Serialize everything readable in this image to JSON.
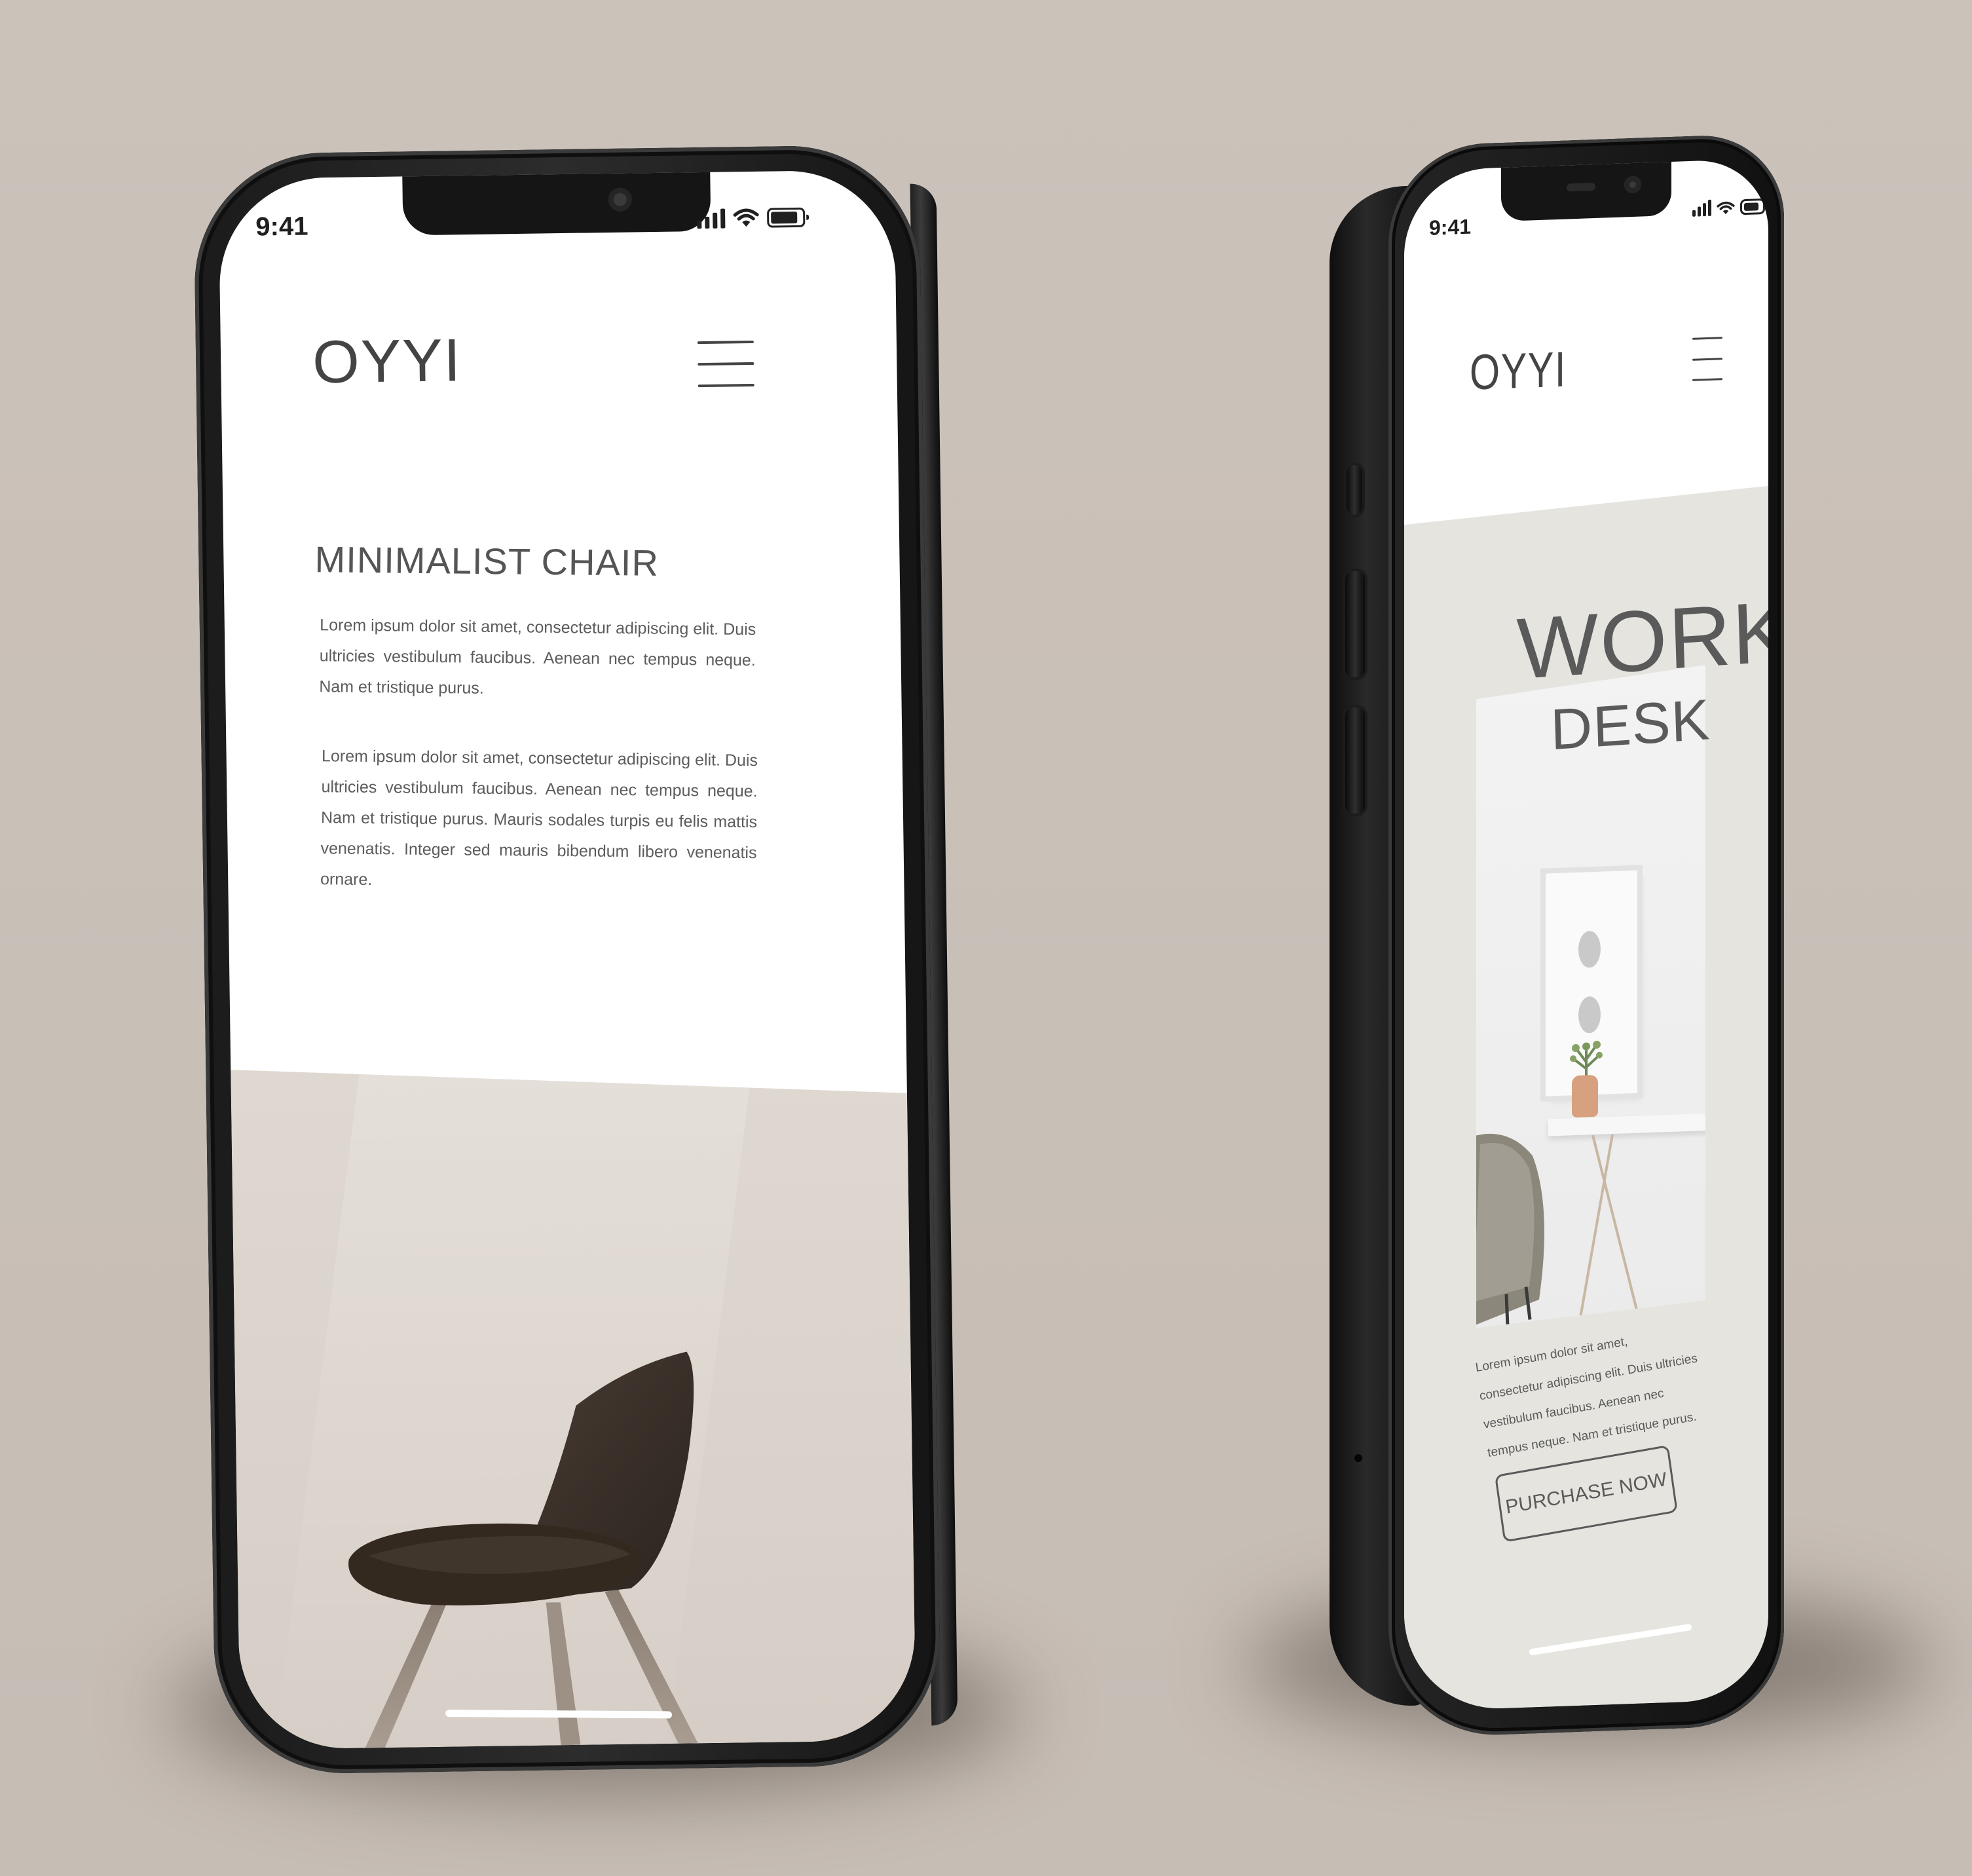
{
  "phone1": {
    "status": {
      "time": "9:41"
    },
    "brand": "OYYI",
    "product_title": "MINIMALIST CHAIR",
    "paragraphs": [
      "Lorem ipsum dolor sit amet, consectetur adipiscing elit. Duis ultricies vestibulum faucibus. Aenean nec tempus neque. Nam et tristique purus.",
      "Lorem ipsum dolor sit amet, consectetur adipiscing elit. Duis ultricies vestibulum faucibus. Aenean nec tempus neque. Nam et tristique purus. Mauris sodales turpis eu felis mattis venenatis. Integer sed mauris bibendum libero venenatis ornare."
    ]
  },
  "phone2": {
    "status": {
      "time": "9:41"
    },
    "brand": "OYYI",
    "headline_line1": "WORK",
    "headline_line2": "DESK",
    "paragraph": "Lorem ipsum dolor sit amet, consectetur adipiscing elit. Duis ultricies vestibulum faucibus. Aenean nec tempus neque. Nam et tristique purus.",
    "cta_label": "PURCHASE NOW"
  },
  "colors": {
    "background": "#c9c0b8",
    "phone_frame": "#1b1b1b",
    "screen": "#ffffff",
    "text": "#555555",
    "hero_chair_bg": "#dcd5ce",
    "hero_desk_bg": "#e5e4df"
  },
  "icons": [
    "signal-icon",
    "wifi-icon",
    "battery-icon",
    "menu-icon"
  ]
}
